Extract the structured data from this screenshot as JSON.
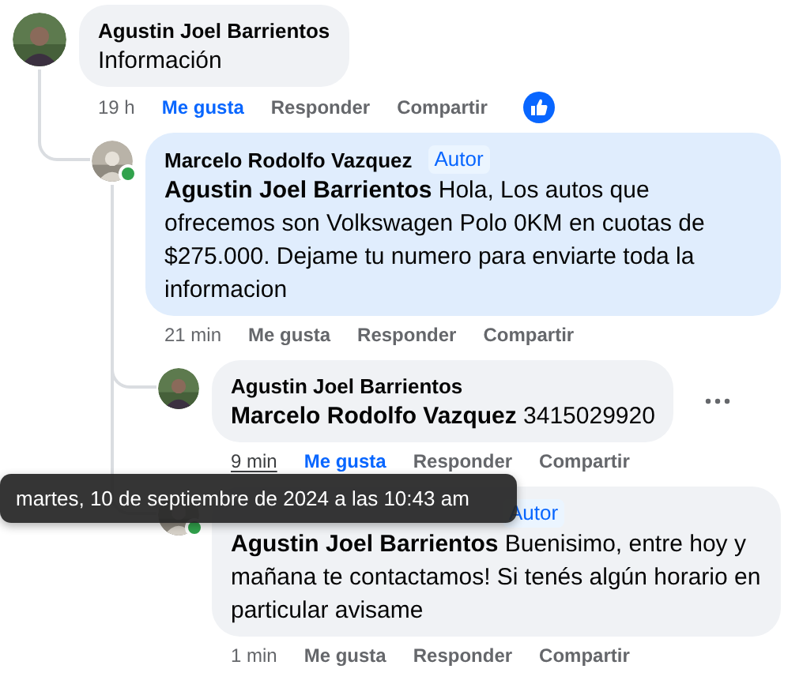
{
  "comments": [
    {
      "author": "Agustin Joel Barrientos",
      "online": false,
      "highlighted": false,
      "text": "Información",
      "time": "19 h",
      "time_hovered": false,
      "liked": true,
      "actions": [
        "Me gusta",
        "Responder",
        "Compartir"
      ],
      "like_reaction": true,
      "more_menu": false,
      "children": [
        {
          "author": "Marcelo Rodolfo Vazquez",
          "badge": "Autor",
          "online": true,
          "highlighted": true,
          "text": "**Agustin Joel Barrientos** Hola, Los autos que ofrecemos son Volkswagen Polo 0KM en cuotas de $275.000. Dejame tu numero para enviarte toda la informacion",
          "time": "21 min",
          "time_hovered": false,
          "liked": false,
          "actions": [
            "Me gusta",
            "Responder",
            "Compartir"
          ],
          "like_reaction": false,
          "more_menu": false,
          "children": [
            {
              "author": "Agustin Joel Barrientos",
              "online": false,
              "highlighted": false,
              "text": "**Marcelo Rodolfo Vazquez** 3415029920",
              "time": "9 min",
              "time_hovered": true,
              "liked": true,
              "actions": [
                "Me gusta",
                "Responder",
                "Compartir"
              ],
              "like_reaction": false,
              "more_menu": true
            },
            {
              "badge": "Autor",
              "online": true,
              "highlighted": false,
              "text": "**Agustin Joel Barrientos** Buenisimo, entre hoy y mañana te contactamos! Si tenés algún horario en particular avisame",
              "time": "1 min",
              "time_hovered": false,
              "liked": false,
              "actions": [
                "Me gusta",
                "Responder",
                "Compartir"
              ],
              "like_reaction": false,
              "more_menu": false
            }
          ]
        }
      ]
    }
  ],
  "tooltip": {
    "text": "martes, 10 de septiembre de 2024 a las 10:43 am"
  }
}
